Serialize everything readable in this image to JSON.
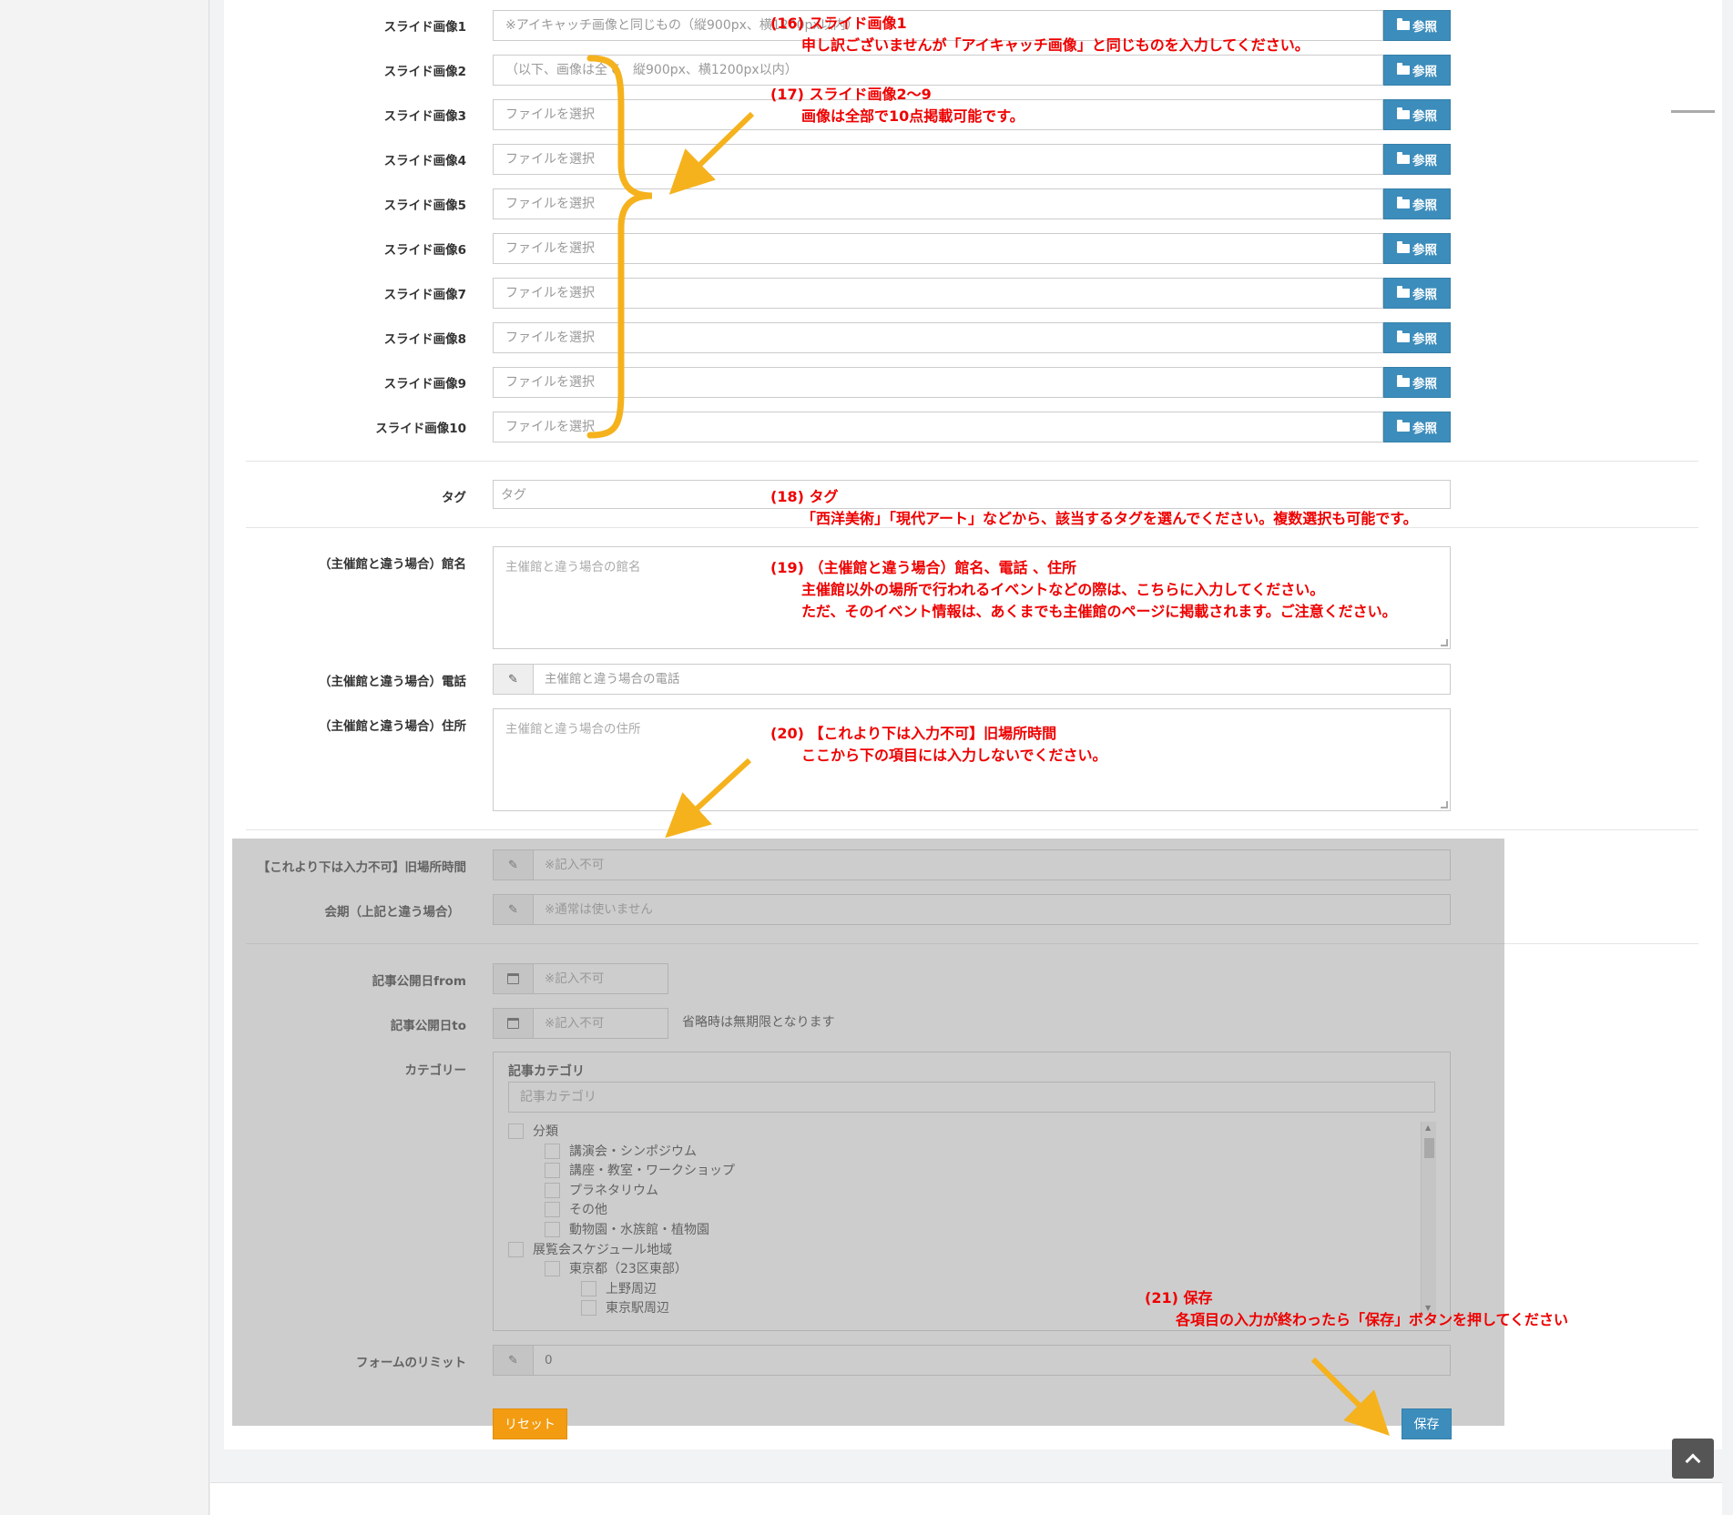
{
  "browse_label": "参照",
  "slides": [
    {
      "label": "スライド画像1",
      "placeholder": "※アイキャッチ画像と同じもの（縦900px、横1200px以内）"
    },
    {
      "label": "スライド画像2",
      "placeholder": "（以下、画像は全て　縦900px、横1200px以内）"
    },
    {
      "label": "スライド画像3",
      "placeholder": "ファイルを選択"
    },
    {
      "label": "スライド画像4",
      "placeholder": "ファイルを選択"
    },
    {
      "label": "スライド画像5",
      "placeholder": "ファイルを選択"
    },
    {
      "label": "スライド画像6",
      "placeholder": "ファイルを選択"
    },
    {
      "label": "スライド画像7",
      "placeholder": "ファイルを選択"
    },
    {
      "label": "スライド画像8",
      "placeholder": "ファイルを選択"
    },
    {
      "label": "スライド画像9",
      "placeholder": "ファイルを選択"
    },
    {
      "label": "スライド画像10",
      "placeholder": "ファイルを選択"
    }
  ],
  "tag": {
    "label": "タグ",
    "placeholder": "タグ"
  },
  "venue": {
    "name_label": "（主催館と違う場合）館名",
    "name_placeholder": "主催館と違う場合の館名",
    "phone_label": "（主催館と違う場合）電話",
    "phone_placeholder": "主催館と違う場合の電話",
    "address_label": "（主催館と違う場合）住所",
    "address_placeholder": "主催館と違う場合の住所"
  },
  "legacy": {
    "place_time_label": "【これより下は入力不可】旧場所時間",
    "place_time_placeholder": "※記入不可",
    "period_label": "会期（上記と違う場合）",
    "period_placeholder": "※通常は使いません"
  },
  "publish": {
    "from_label": "記事公開日from",
    "from_placeholder": "※記入不可",
    "to_label": "記事公開日to",
    "to_placeholder": "※記入不可",
    "to_note": "省略時は無期限となります"
  },
  "category": {
    "label": "カテゴリー",
    "box_title": "記事カテゴリ",
    "search_placeholder": "記事カテゴリ",
    "tree": [
      "分類",
      "講演会・シンポジウム",
      "講座・教室・ワークショップ",
      "プラネタリウム",
      "その他",
      "動物園・水族館・植物園",
      "展覧会スケジュール地域",
      "東京都（23区東部）",
      "上野周辺",
      "東京駅周辺"
    ]
  },
  "form_limit": {
    "label": "フォームのリミット",
    "value": "0"
  },
  "buttons": {
    "reset": "リセット",
    "save": "保存"
  },
  "annotations": [
    {
      "title": "(16) スライド画像1",
      "lines": [
        "申し訳ございませんが「アイキャッチ画像」と同じものを入力してください。"
      ]
    },
    {
      "title": "(17) スライド画像2～9",
      "lines": [
        "画像は全部で10点掲載可能です。"
      ]
    },
    {
      "title": "(18) タグ",
      "lines": [
        "「西洋美術」「現代アート」などから、該当するタグを選んでください。複数選択も可能です。"
      ]
    },
    {
      "title": "(19) （主催館と違う場合）館名、電話 、住所",
      "lines": [
        "主催館以外の場所で行われるイベントなどの際は、こちらに入力してください。",
        "ただ、そのイベント情報は、あくまでも主催館のページに掲載されます。ご注意ください。"
      ]
    },
    {
      "title": "(20) 【これより下は入力不可】旧場所時間",
      "lines": [
        "ここから下の項目には入力しないでください。"
      ]
    },
    {
      "title": "(21) 保存",
      "lines": [
        "各項目の入力が終わったら「保存」ボタンを押してください"
      ]
    }
  ],
  "colors": {
    "accent": "#3c8dbc",
    "warning": "#f39c12",
    "annotation": "#e00000",
    "highlight": "#f5b21d"
  }
}
